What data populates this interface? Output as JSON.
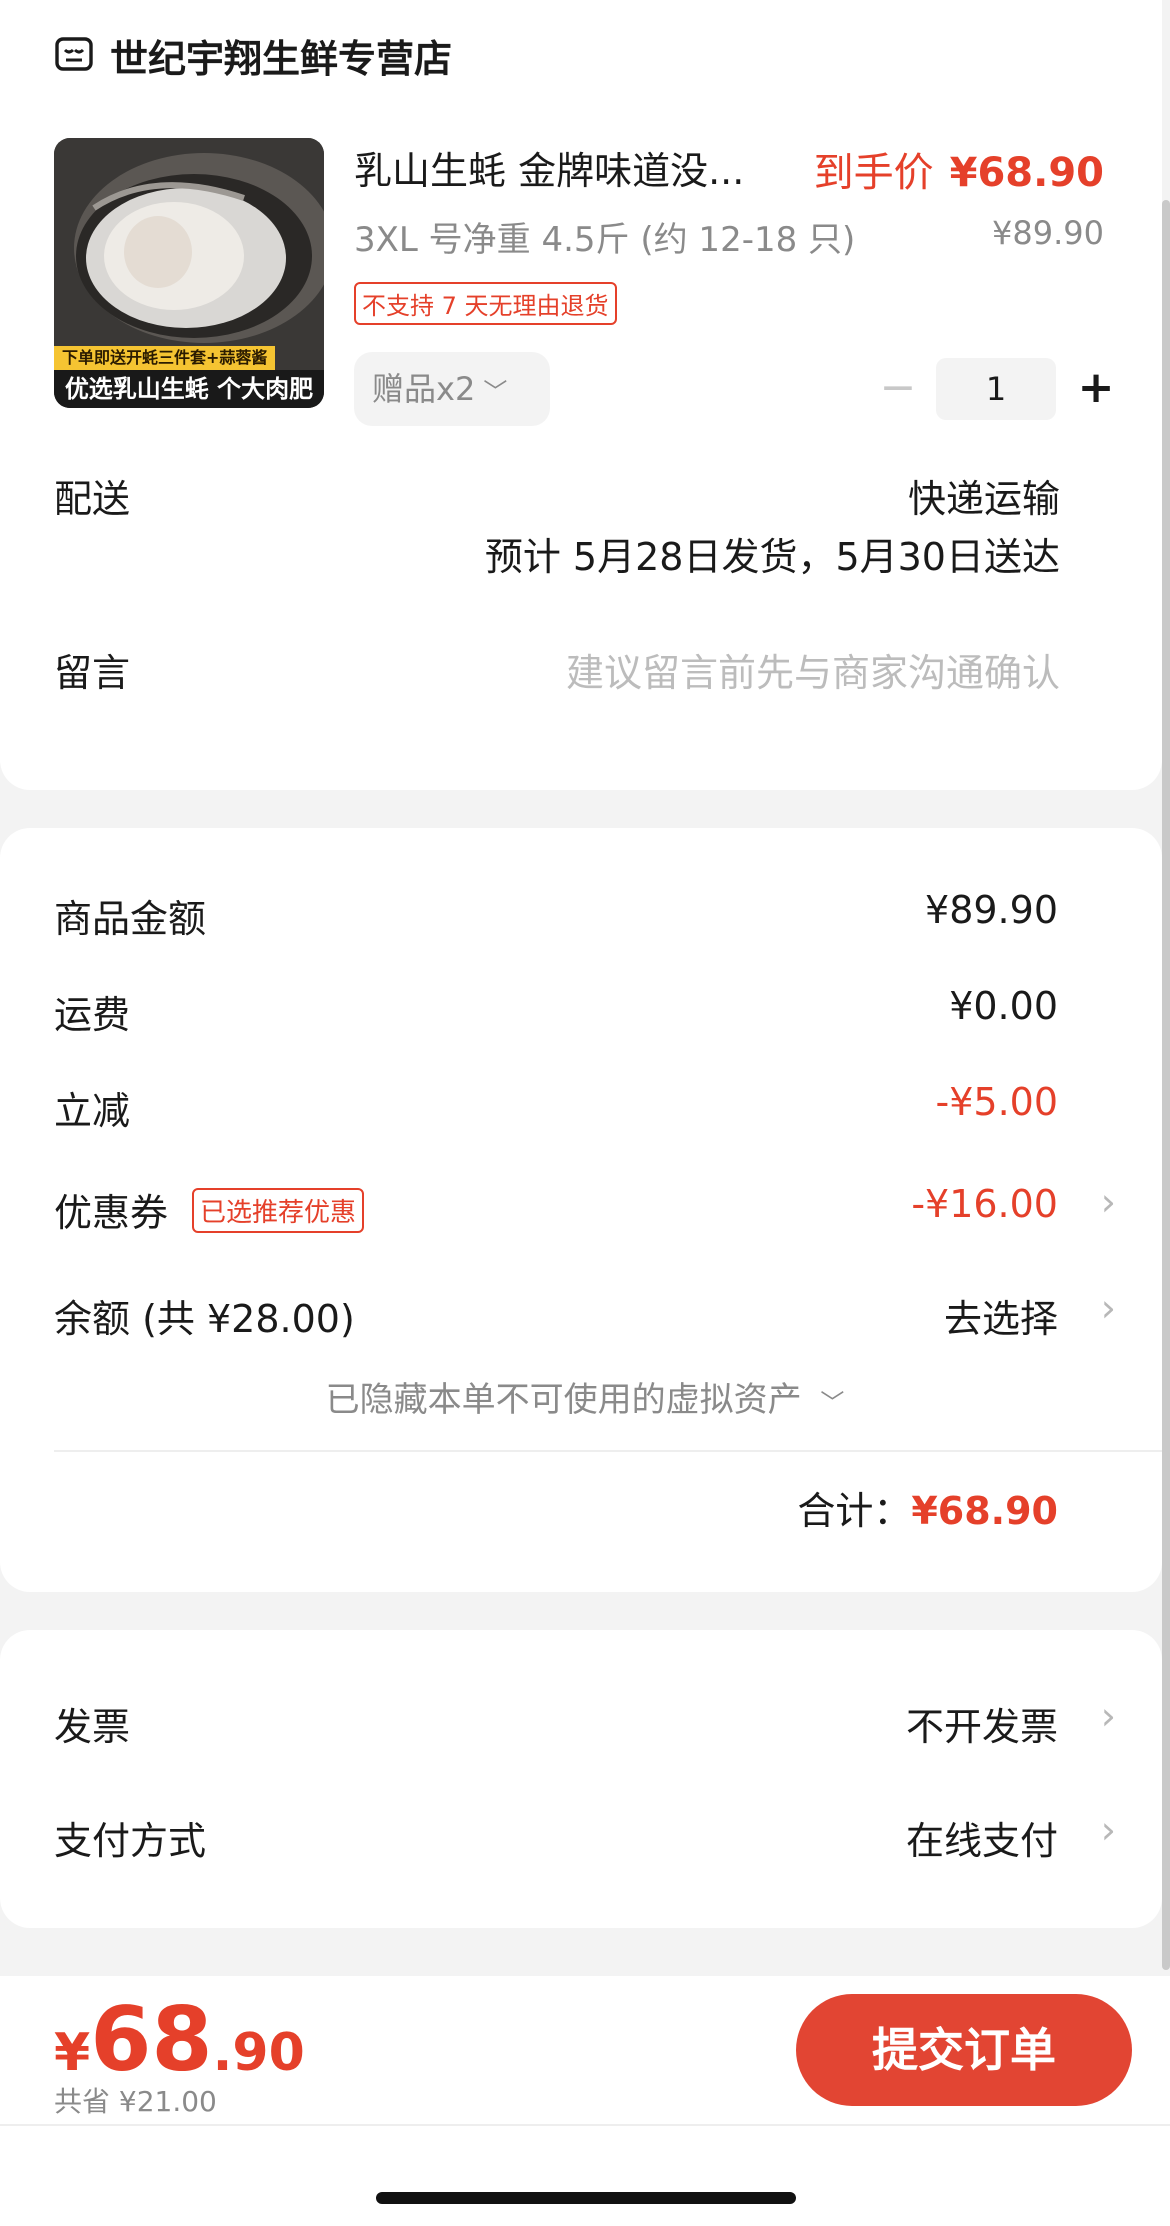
{
  "store": {
    "name": "世纪宇翔生鲜专营店",
    "icon": "store-icon"
  },
  "product": {
    "title": "乳山生蚝 金牌味道没...",
    "price_label": "到手价",
    "price": "¥68.90",
    "spec": "3XL 号净重 4.5斤 (约 12-18 只)",
    "original_price": "¥89.90",
    "return_badge": "不支持 7 天无理由退货",
    "gift_label": "赠品x2",
    "quantity": "1",
    "image_tag": "下单即送开蚝三件套+蒜蓉酱",
    "image_caption": "优选乳山生蚝 个大肉肥"
  },
  "delivery": {
    "label": "配送",
    "method": "快递运输",
    "estimate": "预计 5月28日发货，5月30日送达"
  },
  "message": {
    "label": "留言",
    "placeholder": "建议留言前先与商家沟通确认"
  },
  "summary": {
    "items_label": "商品金额",
    "items_value": "¥89.90",
    "shipping_label": "运费",
    "shipping_value": "¥0.00",
    "discount_label": "立减",
    "discount_value": "-¥5.00",
    "coupon_label": "优惠券",
    "coupon_badge": "已选推荐优惠",
    "coupon_value": "-¥16.00",
    "balance_label": "余额 (共 ¥28.00)",
    "balance_action": "去选择",
    "hidden_assets": "已隐藏本单不可使用的虚拟资产",
    "total_label": "合计：",
    "total_value": "¥68.90"
  },
  "invoice": {
    "label": "发票",
    "value": "不开发票"
  },
  "payment": {
    "label": "支付方式",
    "value": "在线支付"
  },
  "bottom": {
    "currency": "¥",
    "price_int": "68",
    "price_dec": ".90",
    "savings": "共省 ¥21.00",
    "submit_label": "提交订单"
  },
  "colors": {
    "accent": "#e5402a",
    "button": "#e24533"
  }
}
